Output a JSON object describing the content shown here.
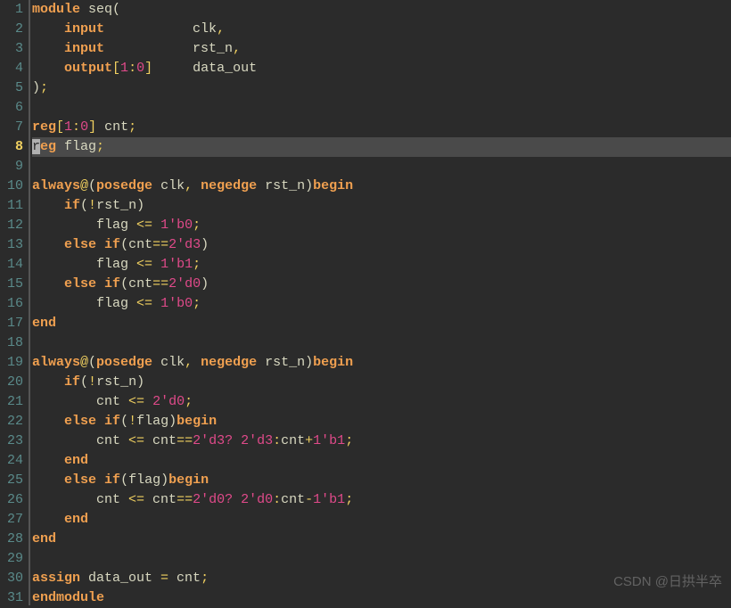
{
  "watermark": "CSDN @日拱半卒",
  "current_line": 8,
  "lines": [
    {
      "n": 1,
      "t": [
        [
          "kw",
          "module"
        ],
        [
          "id",
          " seq"
        ],
        [
          "paren",
          "("
        ]
      ]
    },
    {
      "n": 2,
      "t": [
        [
          "id",
          "    "
        ],
        [
          "kw",
          "input"
        ],
        [
          "id",
          "           clk"
        ],
        [
          "punct",
          ","
        ]
      ]
    },
    {
      "n": 3,
      "t": [
        [
          "id",
          "    "
        ],
        [
          "kw",
          "input"
        ],
        [
          "id",
          "           rst_n"
        ],
        [
          "punct",
          ","
        ]
      ]
    },
    {
      "n": 4,
      "t": [
        [
          "id",
          "    "
        ],
        [
          "kw",
          "output"
        ],
        [
          "punct",
          "["
        ],
        [
          "num",
          "1"
        ],
        [
          "punct",
          ":"
        ],
        [
          "num",
          "0"
        ],
        [
          "punct",
          "]"
        ],
        [
          "id",
          "     data_out"
        ]
      ]
    },
    {
      "n": 5,
      "t": [
        [
          "paren",
          ")"
        ],
        [
          "punct",
          ";"
        ]
      ]
    },
    {
      "n": 6,
      "t": []
    },
    {
      "n": 7,
      "t": [
        [
          "kw",
          "reg"
        ],
        [
          "punct",
          "["
        ],
        [
          "num",
          "1"
        ],
        [
          "punct",
          ":"
        ],
        [
          "num",
          "0"
        ],
        [
          "punct",
          "]"
        ],
        [
          "id",
          " cnt"
        ],
        [
          "punct",
          ";"
        ]
      ]
    },
    {
      "n": 8,
      "t": [
        [
          "cursor",
          "r"
        ],
        [
          "kw",
          "eg"
        ],
        [
          "id",
          " flag"
        ],
        [
          "punct",
          ";"
        ]
      ],
      "hl": true
    },
    {
      "n": 9,
      "t": []
    },
    {
      "n": 10,
      "t": [
        [
          "kw",
          "always"
        ],
        [
          "punct",
          "@"
        ],
        [
          "paren",
          "("
        ],
        [
          "kw",
          "posedge"
        ],
        [
          "id",
          " clk"
        ],
        [
          "punct",
          ","
        ],
        [
          "id",
          " "
        ],
        [
          "kw",
          "negedge"
        ],
        [
          "id",
          " rst_n"
        ],
        [
          "paren",
          ")"
        ],
        [
          "kw",
          "begin"
        ]
      ]
    },
    {
      "n": 11,
      "t": [
        [
          "id",
          "    "
        ],
        [
          "kw",
          "if"
        ],
        [
          "paren",
          "("
        ],
        [
          "punct",
          "!"
        ],
        [
          "id",
          "rst_n"
        ],
        [
          "paren",
          ")"
        ]
      ]
    },
    {
      "n": 12,
      "t": [
        [
          "id",
          "        flag "
        ],
        [
          "op",
          "<="
        ],
        [
          "id",
          " "
        ],
        [
          "num",
          "1'b0"
        ],
        [
          "punct",
          ";"
        ]
      ]
    },
    {
      "n": 13,
      "t": [
        [
          "id",
          "    "
        ],
        [
          "kw",
          "else"
        ],
        [
          "id",
          " "
        ],
        [
          "kw",
          "if"
        ],
        [
          "paren",
          "("
        ],
        [
          "id",
          "cnt"
        ],
        [
          "op",
          "=="
        ],
        [
          "num",
          "2'd3"
        ],
        [
          "paren",
          ")"
        ]
      ]
    },
    {
      "n": 14,
      "t": [
        [
          "id",
          "        flag "
        ],
        [
          "op",
          "<="
        ],
        [
          "id",
          " "
        ],
        [
          "num",
          "1'b1"
        ],
        [
          "punct",
          ";"
        ]
      ]
    },
    {
      "n": 15,
      "t": [
        [
          "id",
          "    "
        ],
        [
          "kw",
          "else"
        ],
        [
          "id",
          " "
        ],
        [
          "kw",
          "if"
        ],
        [
          "paren",
          "("
        ],
        [
          "id",
          "cnt"
        ],
        [
          "op",
          "=="
        ],
        [
          "num",
          "2'd0"
        ],
        [
          "paren",
          ")"
        ]
      ]
    },
    {
      "n": 16,
      "t": [
        [
          "id",
          "        flag "
        ],
        [
          "op",
          "<="
        ],
        [
          "id",
          " "
        ],
        [
          "num",
          "1'b0"
        ],
        [
          "punct",
          ";"
        ]
      ]
    },
    {
      "n": 17,
      "t": [
        [
          "kw",
          "end"
        ]
      ]
    },
    {
      "n": 18,
      "t": []
    },
    {
      "n": 19,
      "t": [
        [
          "kw",
          "always"
        ],
        [
          "punct",
          "@"
        ],
        [
          "paren",
          "("
        ],
        [
          "kw",
          "posedge"
        ],
        [
          "id",
          " clk"
        ],
        [
          "punct",
          ","
        ],
        [
          "id",
          " "
        ],
        [
          "kw",
          "negedge"
        ],
        [
          "id",
          " rst_n"
        ],
        [
          "paren",
          ")"
        ],
        [
          "kw",
          "begin"
        ]
      ]
    },
    {
      "n": 20,
      "t": [
        [
          "id",
          "    "
        ],
        [
          "kw",
          "if"
        ],
        [
          "paren",
          "("
        ],
        [
          "punct",
          "!"
        ],
        [
          "id",
          "rst_n"
        ],
        [
          "paren",
          ")"
        ]
      ]
    },
    {
      "n": 21,
      "t": [
        [
          "id",
          "        cnt "
        ],
        [
          "op",
          "<="
        ],
        [
          "id",
          " "
        ],
        [
          "num",
          "2'd0"
        ],
        [
          "punct",
          ";"
        ]
      ]
    },
    {
      "n": 22,
      "t": [
        [
          "id",
          "    "
        ],
        [
          "kw",
          "else"
        ],
        [
          "id",
          " "
        ],
        [
          "kw",
          "if"
        ],
        [
          "paren",
          "("
        ],
        [
          "punct",
          "!"
        ],
        [
          "id",
          "flag"
        ],
        [
          "paren",
          ")"
        ],
        [
          "kw",
          "begin"
        ]
      ]
    },
    {
      "n": 23,
      "t": [
        [
          "id",
          "        cnt "
        ],
        [
          "op",
          "<="
        ],
        [
          "id",
          " cnt"
        ],
        [
          "op",
          "=="
        ],
        [
          "num",
          "2'd3?"
        ],
        [
          "id",
          " "
        ],
        [
          "num",
          "2'd3"
        ],
        [
          "punct",
          ":"
        ],
        [
          "id",
          "cnt"
        ],
        [
          "op",
          "+"
        ],
        [
          "num",
          "1'b1"
        ],
        [
          "punct",
          ";"
        ]
      ]
    },
    {
      "n": 24,
      "t": [
        [
          "id",
          "    "
        ],
        [
          "kw",
          "end"
        ]
      ]
    },
    {
      "n": 25,
      "t": [
        [
          "id",
          "    "
        ],
        [
          "kw",
          "else"
        ],
        [
          "id",
          " "
        ],
        [
          "kw",
          "if"
        ],
        [
          "paren",
          "("
        ],
        [
          "id",
          "flag"
        ],
        [
          "paren",
          ")"
        ],
        [
          "kw",
          "begin"
        ]
      ]
    },
    {
      "n": 26,
      "t": [
        [
          "id",
          "        cnt "
        ],
        [
          "op",
          "<="
        ],
        [
          "id",
          " cnt"
        ],
        [
          "op",
          "=="
        ],
        [
          "num",
          "2'd0?"
        ],
        [
          "id",
          " "
        ],
        [
          "num",
          "2'd0"
        ],
        [
          "punct",
          ":"
        ],
        [
          "id",
          "cnt"
        ],
        [
          "op",
          "-"
        ],
        [
          "num",
          "1'b1"
        ],
        [
          "punct",
          ";"
        ]
      ]
    },
    {
      "n": 27,
      "t": [
        [
          "id",
          "    "
        ],
        [
          "kw",
          "end"
        ]
      ]
    },
    {
      "n": 28,
      "t": [
        [
          "kw",
          "end"
        ]
      ]
    },
    {
      "n": 29,
      "t": []
    },
    {
      "n": 30,
      "t": [
        [
          "kw",
          "assign"
        ],
        [
          "id",
          " data_out "
        ],
        [
          "op",
          "="
        ],
        [
          "id",
          " cnt"
        ],
        [
          "punct",
          ";"
        ]
      ]
    },
    {
      "n": 31,
      "t": [
        [
          "kw",
          "endmodule"
        ]
      ]
    }
  ]
}
